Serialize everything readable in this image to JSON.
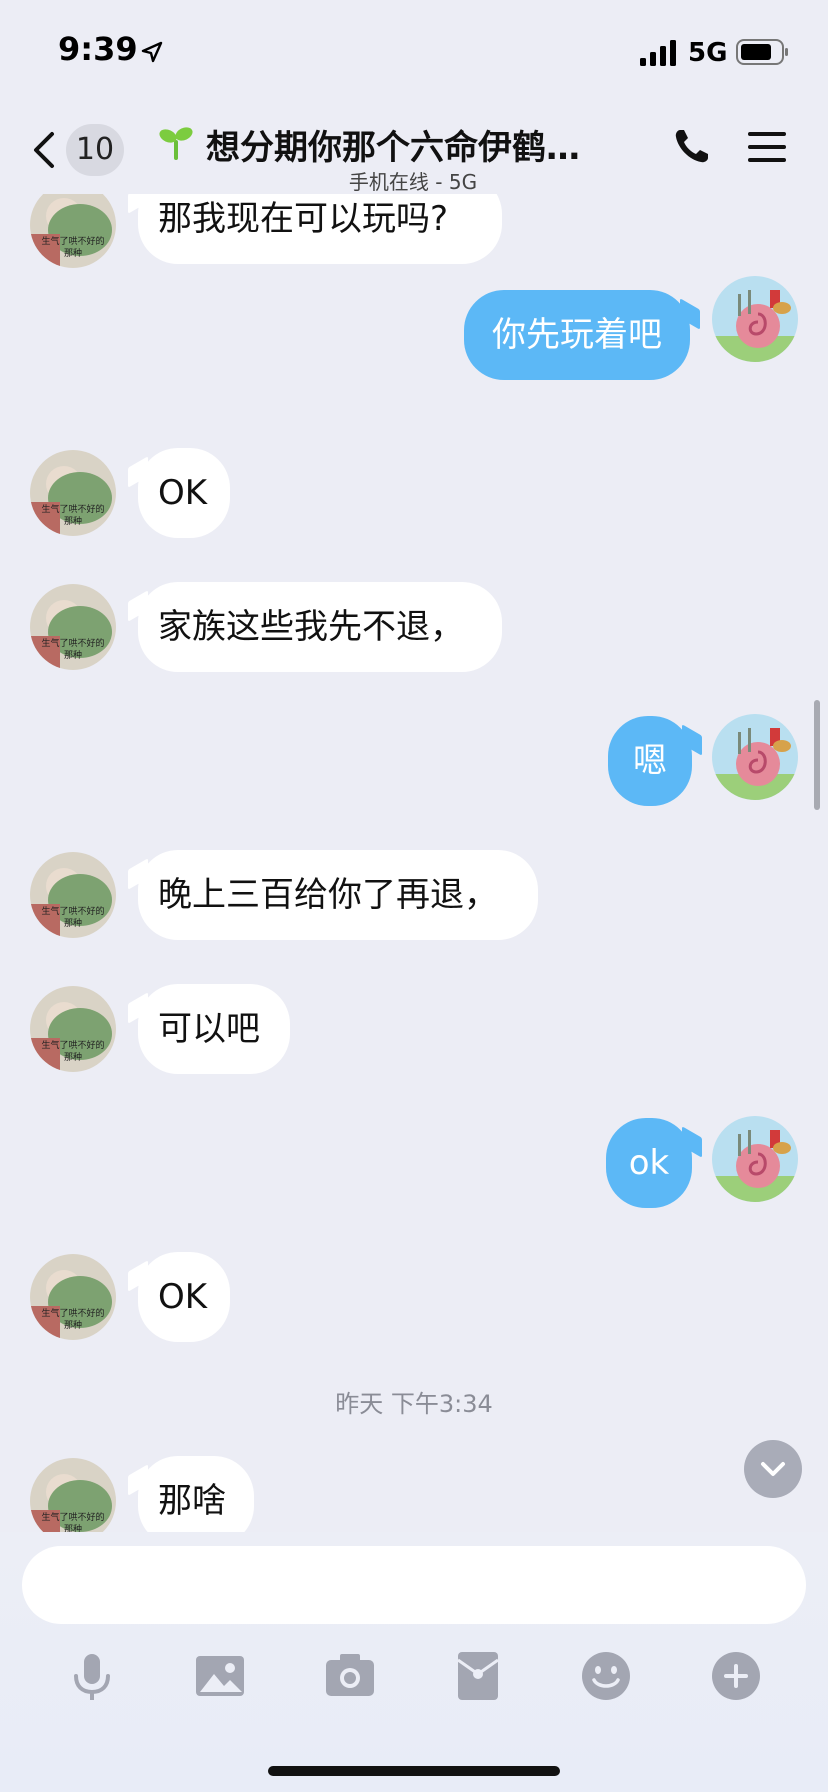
{
  "status": {
    "time": "9:39",
    "network": "5G"
  },
  "nav": {
    "back_count": "10",
    "title": "想分期你那个六命伊鹤…",
    "subtitle": "手机在线 - 5G"
  },
  "messages": [
    {
      "side": "left",
      "text": "那我现在可以玩吗?"
    },
    {
      "side": "right",
      "text": "你先玩着吧"
    },
    {
      "side": "left",
      "text": "OK"
    },
    {
      "side": "left",
      "text": "家族这些我先不退，"
    },
    {
      "side": "right",
      "text": "嗯"
    },
    {
      "side": "left",
      "text": "晚上三百给你了再退，"
    },
    {
      "side": "left",
      "text": "可以吧"
    },
    {
      "side": "right",
      "text": "ok"
    },
    {
      "side": "left",
      "text": "OK"
    },
    {
      "side": "left",
      "text": "那啥"
    }
  ],
  "timestamp": "昨天 下午3:34",
  "avatar_caption": [
    "生气了哄不好的",
    "那种"
  ],
  "input": {
    "placeholder": ""
  },
  "toolbar": [
    "mic-icon",
    "image-icon",
    "camera-icon",
    "red-packet-icon",
    "emoji-icon",
    "plus-icon"
  ],
  "colors": {
    "bubble_out": "#5cb8f6",
    "bubble_in": "#ffffff",
    "background": "#ecedf5",
    "icon_gray": "#a3a6b2"
  }
}
